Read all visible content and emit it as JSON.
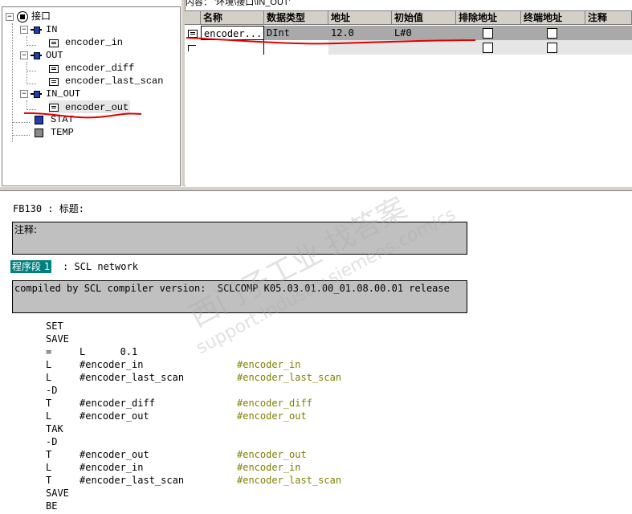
{
  "content_path": "内容： '环境\\接口\\IN_OUT'",
  "tree": {
    "root": "接口",
    "items": [
      {
        "label": "IN",
        "kind": "section"
      },
      {
        "label": "encoder_in",
        "kind": "param"
      },
      {
        "label": "OUT",
        "kind": "section"
      },
      {
        "label": "encoder_diff",
        "kind": "param"
      },
      {
        "label": "encoder_last_scan",
        "kind": "param"
      },
      {
        "label": "IN_OUT",
        "kind": "section"
      },
      {
        "label": "encoder_out",
        "kind": "param"
      },
      {
        "label": "STAT",
        "kind": "block"
      },
      {
        "label": "TEMP",
        "kind": "block"
      }
    ]
  },
  "grid": {
    "headers": [
      "名称",
      "数据类型",
      "地址",
      "初始值",
      "排除地址",
      "终端地址",
      "注释"
    ],
    "rows": [
      {
        "name": "encoder...",
        "type": "DInt",
        "address": "12.0",
        "initial": "L#0",
        "exclude": false,
        "terminal": false,
        "comment": ""
      }
    ]
  },
  "code": {
    "block_title": "FB130 : 标题:",
    "comment_label": "注释:",
    "network_label": "程序段 1",
    "network_title": ": SCL network",
    "network_comment": "compiled by SCL compiler version:  SCLCOMP K05.03.01.00_01.08.00.01 release",
    "lines": [
      {
        "op": "SET",
        "arg": "",
        "cmt": ""
      },
      {
        "op": "SAVE",
        "arg": "",
        "cmt": ""
      },
      {
        "op": "=",
        "arg": "L      0.1",
        "cmt": ""
      },
      {
        "op": "L",
        "arg": "#encoder_in",
        "cmt": "#encoder_in"
      },
      {
        "op": "L",
        "arg": "#encoder_last_scan",
        "cmt": "#encoder_last_scan"
      },
      {
        "op": "-D",
        "arg": "",
        "cmt": ""
      },
      {
        "op": "T",
        "arg": "#encoder_diff",
        "cmt": "#encoder_diff"
      },
      {
        "op": "L",
        "arg": "#encoder_out",
        "cmt": "#encoder_out"
      },
      {
        "op": "TAK",
        "arg": "",
        "cmt": ""
      },
      {
        "op": "-D",
        "arg": "",
        "cmt": ""
      },
      {
        "op": "T",
        "arg": "#encoder_out",
        "cmt": "#encoder_out"
      },
      {
        "op": "L",
        "arg": "#encoder_in",
        "cmt": "#encoder_in"
      },
      {
        "op": "T",
        "arg": "#encoder_last_scan",
        "cmt": "#encoder_last_scan"
      },
      {
        "op": "SAVE",
        "arg": "",
        "cmt": ""
      },
      {
        "op": "BE",
        "arg": "",
        "cmt": ""
      }
    ]
  },
  "watermark": {
    "line1": "西门子工业  找答案",
    "line2": "support.industry.siemens.com/cs"
  },
  "colors": {
    "network_label_bg": "#008080",
    "symbol_comment": "#808000",
    "selected_row": "#a9a9a9",
    "annotation_red": "#e00000"
  }
}
